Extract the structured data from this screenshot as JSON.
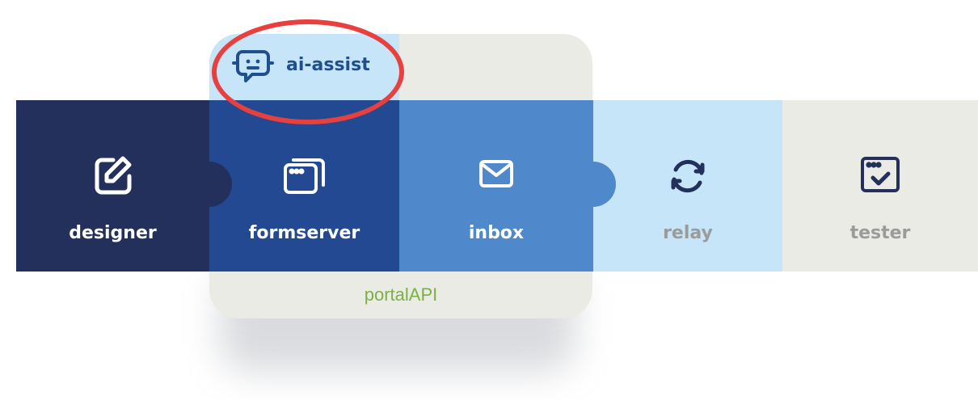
{
  "portal": {
    "label": "portalAPI"
  },
  "ai_assist": {
    "label": "ai-assist",
    "icon": "robot-chat-icon",
    "highlight_color": "#e8403e"
  },
  "modules": [
    {
      "label": "designer",
      "icon": "edit-square-icon",
      "color": "#22305b"
    },
    {
      "label": "formserver",
      "icon": "browser-windows-icon",
      "color": "#234992"
    },
    {
      "label": "inbox",
      "icon": "mail-icon",
      "color": "#4f89cc"
    },
    {
      "label": "relay",
      "icon": "sync-arrows-icon",
      "color": "#c7e5f8"
    },
    {
      "label": "tester",
      "icon": "checked-window-icon",
      "color": "#ebebe6"
    }
  ],
  "colors": {
    "portal_background": "#ebebe6",
    "portal_label": "#79b243",
    "dark_icon": "#22305b"
  }
}
